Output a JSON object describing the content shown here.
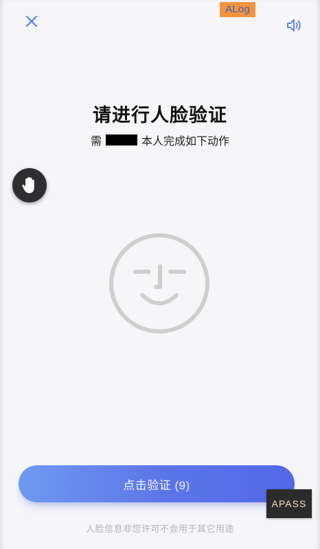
{
  "header": {
    "close_icon": "close-icon",
    "debug_badge": "ALog",
    "sound_icon": "speaker-icon"
  },
  "main": {
    "title": "请进行人脸验证",
    "subtitle_prefix": "需",
    "subtitle_suffix": "本人完成如下动作",
    "face_icon": "smiling-face-icon"
  },
  "floating": {
    "hand_icon": "hand-icon"
  },
  "footer": {
    "verify_button_label": "点击验证 (9)",
    "privacy_note": "人脸信息非您许可不会用于其它用途",
    "watermark": "APASS"
  },
  "colors": {
    "accent_start": "#6f9af0",
    "accent_end": "#5368e6",
    "icon_blue": "#4a7be8",
    "face_gray": "#cfcfcf"
  }
}
